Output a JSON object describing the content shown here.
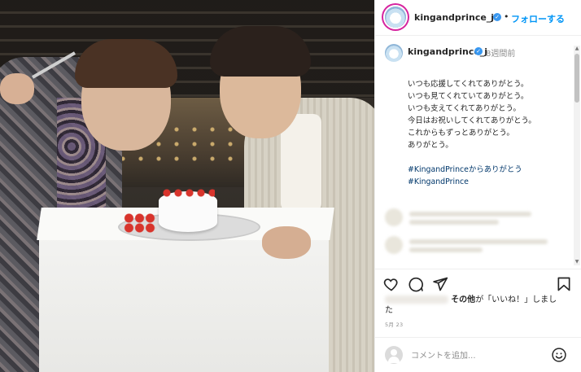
{
  "header": {
    "username": "kingandprince_j",
    "verified_icon": "verified-badge-icon",
    "dot": "•",
    "follow_label": "フォローする"
  },
  "post": {
    "username": "kingandprince_j",
    "time_ago": "8週間前",
    "caption_lines": [
      "いつも応援してくれてありがとう。",
      "いつも見てくれていてありがとう。",
      "いつも支えてくれてありがとう。",
      "今日はお祝いしてくれてありがとう。",
      "これからもずっとありがとう。",
      "ありがとう。"
    ],
    "hashtags": [
      "#KingandPrinceからありがとう",
      "#KingandPrince"
    ]
  },
  "actions": {
    "like_icon": "heart-icon",
    "comment_icon": "comment-icon",
    "share_icon": "share-icon",
    "save_icon": "bookmark-icon"
  },
  "likes": {
    "suffix_bold": "その他",
    "suffix_text": "が「いいね！」しまし",
    "suffix_text2": "た"
  },
  "date": "5月 23",
  "comment_box": {
    "placeholder": "コメントを追加...",
    "emoji_icon": "smile-emoji-icon"
  },
  "colors": {
    "accent": "#0095f6",
    "hashtag": "#00376b",
    "verified": "#3897f0",
    "muted": "#8e8e8e"
  }
}
